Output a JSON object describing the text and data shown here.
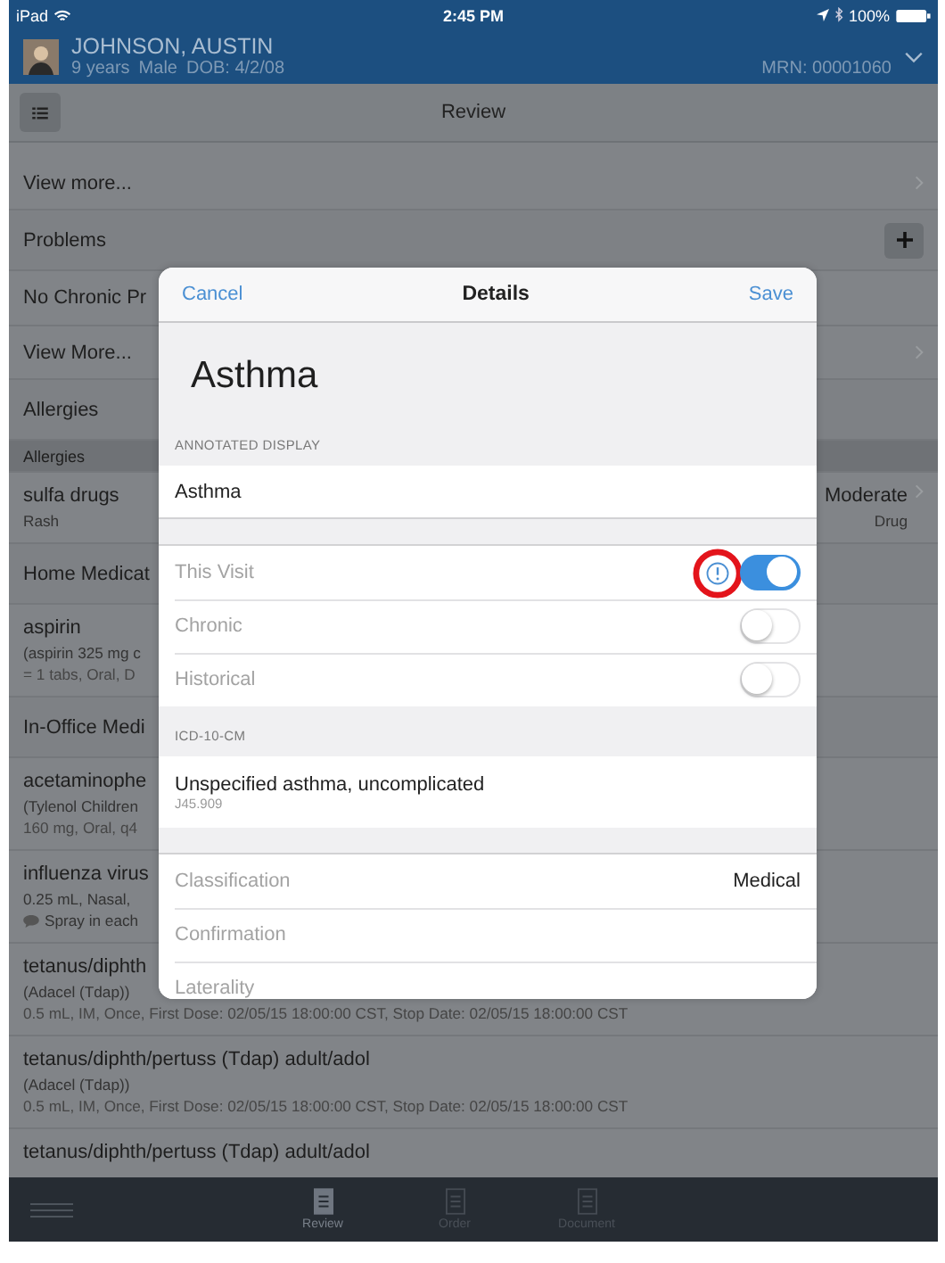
{
  "status_bar": {
    "device": "iPad",
    "time": "2:45 PM",
    "battery": "100%"
  },
  "patient": {
    "name": "JOHNSON, AUSTIN",
    "age": "9 years",
    "sex": "Male",
    "dob": "DOB: 4/2/08",
    "mrn": "MRN: 00001060"
  },
  "toolbar": {
    "title": "Review"
  },
  "list": [
    {
      "kind": "link",
      "label": "View more..."
    },
    {
      "kind": "section",
      "label": "Problems",
      "add": true
    },
    {
      "kind": "text",
      "label": "No Chronic Pr"
    },
    {
      "kind": "link",
      "label": "View More..."
    },
    {
      "kind": "section",
      "label": "Allergies",
      "add": false
    },
    {
      "kind": "subheader",
      "label": "Allergies"
    },
    {
      "kind": "entry",
      "lines": [
        "sulfa drugs",
        "Rash"
      ],
      "right": [
        "Moderate",
        "Drug"
      ]
    },
    {
      "kind": "section",
      "label": "Home Medicat",
      "add": false
    },
    {
      "kind": "entry",
      "lines": [
        "aspirin",
        "(aspirin 325 mg c",
        "= 1 tabs, Oral, D"
      ]
    },
    {
      "kind": "section",
      "label": "In-Office Medi",
      "add": false
    },
    {
      "kind": "entry",
      "lines": [
        "acetaminophe",
        "(Tylenol Children",
        "160 mg, Oral, q4"
      ]
    },
    {
      "kind": "entry",
      "lines": [
        "influenza virus",
        "0.25 mL, Nasal,"
      ],
      "note": "Spray in each"
    },
    {
      "kind": "entry",
      "lines": [
        "tetanus/diphth",
        "(Adacel (Tdap))",
        "0.5 mL, IM, Once, First Dose: 02/05/15 18:00:00 CST, Stop Date: 02/05/15 18:00:00 CST"
      ]
    },
    {
      "kind": "entry",
      "lines": [
        "tetanus/diphth/pertuss (Tdap) adult/adol",
        "(Adacel (Tdap))",
        "0.5 mL, IM, Once, First Dose: 02/05/15 18:00:00 CST, Stop Date: 02/05/15 18:00:00 CST"
      ]
    },
    {
      "kind": "entry",
      "lines": [
        "tetanus/diphth/pertuss (Tdap) adult/adol"
      ]
    }
  ],
  "tab_bar": [
    {
      "label": "Review",
      "selected": true
    },
    {
      "label": "Order",
      "selected": false
    },
    {
      "label": "Document",
      "selected": false
    }
  ],
  "modal": {
    "cancel": "Cancel",
    "title": "Details",
    "save": "Save",
    "heading": "Asthma",
    "rows": [
      {
        "kind": "header",
        "label": "ANNOTATED DISPLAY"
      },
      {
        "kind": "value",
        "label": "Asthma"
      },
      {
        "kind": "gap"
      },
      {
        "kind": "toggle",
        "label": "This Visit",
        "on": true,
        "alert": true
      },
      {
        "kind": "toggle",
        "label": "Chronic",
        "on": false,
        "alert": false
      },
      {
        "kind": "toggle",
        "label": "Historical",
        "on": false,
        "alert": false
      },
      {
        "kind": "header",
        "label": "ICD-10-CM"
      },
      {
        "kind": "detail",
        "label": "Unspecified asthma, uncomplicated",
        "code": "J45.909"
      },
      {
        "kind": "gap"
      },
      {
        "kind": "field",
        "label": "Classification",
        "value": "Medical"
      },
      {
        "kind": "field",
        "label": "Confirmation"
      },
      {
        "kind": "field",
        "label": "Laterality"
      }
    ]
  },
  "annotation": {
    "kind": "circle"
  }
}
